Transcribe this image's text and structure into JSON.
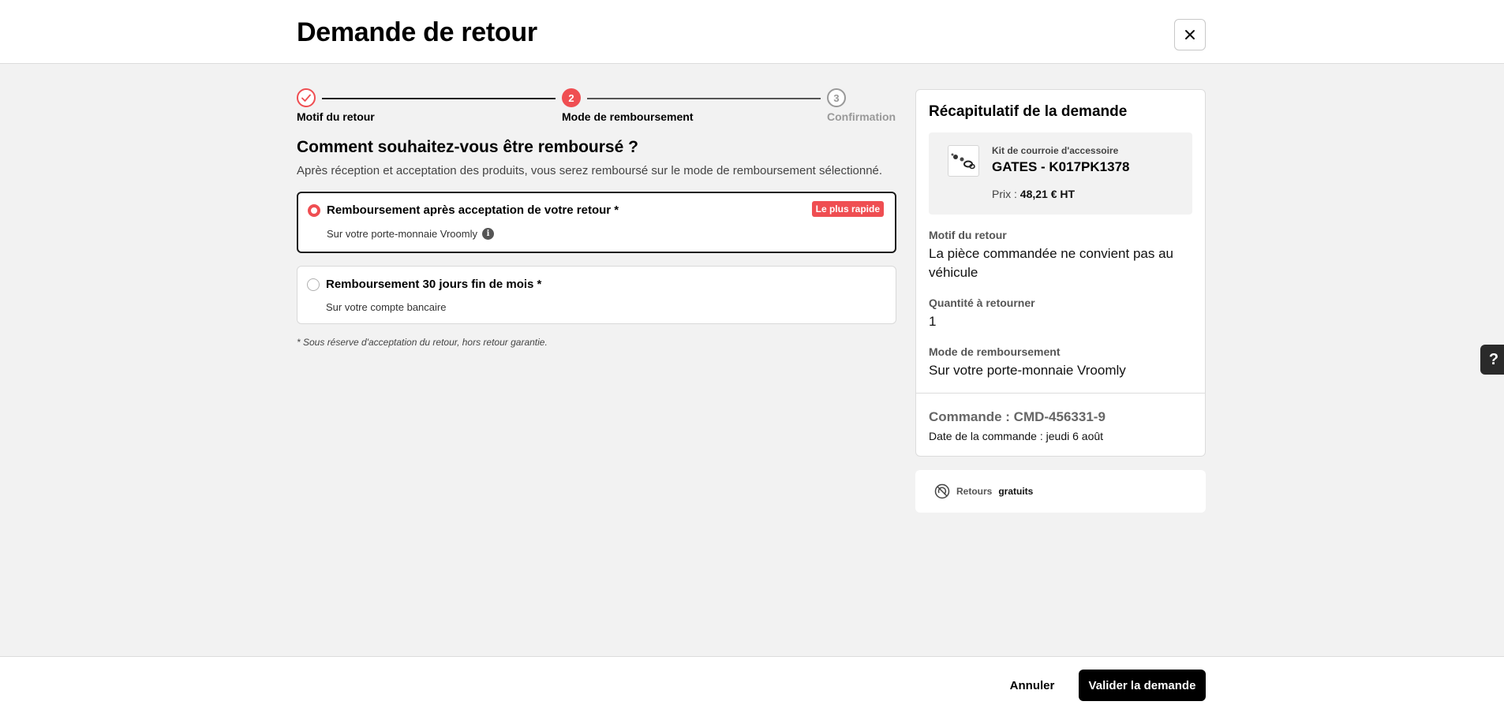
{
  "header": {
    "title": "Demande de retour",
    "close_icon": "close-icon"
  },
  "stepper": {
    "steps": [
      {
        "label": "Motif du retour",
        "marker": "✓",
        "state": "done"
      },
      {
        "label": "Mode de remboursement",
        "marker": "2",
        "state": "current"
      },
      {
        "label": "Confirmation",
        "marker": "3",
        "state": "todo"
      }
    ]
  },
  "main": {
    "title": "Comment souhaitez-vous être remboursé ?",
    "subtitle": "Après réception et acceptation des produits, vous serez remboursé sur le mode de remboursement sélectionné.",
    "options": [
      {
        "title": "Remboursement après acceptation de votre retour *",
        "sub": "Sur votre porte-monnaie Vroomly",
        "badge": "Le plus rapide",
        "selected": true
      },
      {
        "title": "Remboursement 30 jours fin de mois *",
        "sub": "Sur votre compte bancaire",
        "selected": false
      }
    ],
    "footnote": "* Sous réserve d'acceptation du retour, hors retour garantie."
  },
  "summary": {
    "title": "Récapitulatif de la demande",
    "product": {
      "category": "Kit de courroie d'accessoire",
      "name": "GATES - K017PK1378",
      "price_label": "Prix :",
      "price_value": "48,21 € HT"
    },
    "reason_label": "Motif du retour",
    "reason_value": "La pièce commandée ne convient pas au véhicule",
    "quantity_label": "Quantité à retourner",
    "quantity_value": "1",
    "refund_label": "Mode de remboursement",
    "refund_value": "Sur votre porte-monnaie Vroomly",
    "order_number": "Commande : CMD-456331-9",
    "order_date": "Date de la commande : jeudi 6 août"
  },
  "free_returns": {
    "prefix": "Retours",
    "emphasis": "gratuits",
    "icon": "free-returns-icon"
  },
  "help": {
    "label": "?"
  },
  "footer": {
    "cancel_label": "Annuler",
    "submit_label": "Valider la demande"
  },
  "colors": {
    "accent": "#ef4e52",
    "dark": "#000000",
    "background": "#f2f2f2"
  }
}
